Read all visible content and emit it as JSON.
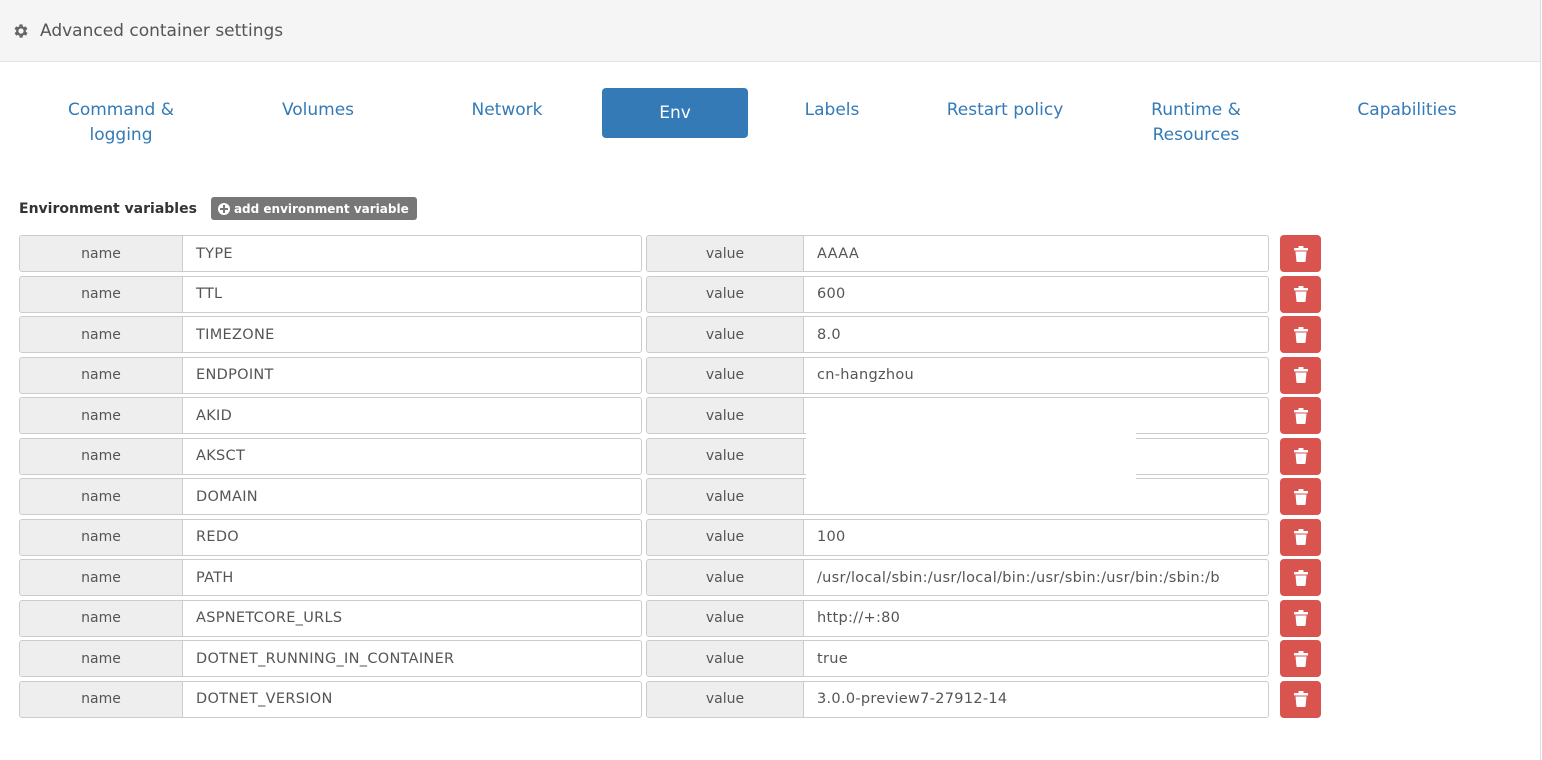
{
  "header": {
    "title": "Advanced container settings",
    "icon": "gear-icon"
  },
  "tabs": [
    {
      "line1": "Command &",
      "line2": "logging",
      "active": false
    },
    {
      "line1": "Volumes",
      "line2": "",
      "active": false
    },
    {
      "line1": "Network",
      "line2": "",
      "active": false
    },
    {
      "line1": "Env",
      "line2": "",
      "active": true
    },
    {
      "line1": "Labels",
      "line2": "",
      "active": false
    },
    {
      "line1": "Restart policy",
      "line2": "",
      "active": false
    },
    {
      "line1": "Runtime &",
      "line2": "Resources",
      "active": false
    },
    {
      "line1": "Capabilities",
      "line2": "",
      "active": false
    }
  ],
  "env": {
    "label": "Environment variables",
    "add_button": "add environment variable",
    "name_addon": "name",
    "value_addon": "value",
    "rows": [
      {
        "name": "TYPE",
        "value": "AAAA"
      },
      {
        "name": "TTL",
        "value": "600"
      },
      {
        "name": "TIMEZONE",
        "value": "8.0"
      },
      {
        "name": "ENDPOINT",
        "value": "cn-hangzhou"
      },
      {
        "name": "AKID",
        "value": ""
      },
      {
        "name": "AKSCT",
        "value": ""
      },
      {
        "name": "DOMAIN",
        "value": ""
      },
      {
        "name": "REDO",
        "value": "100"
      },
      {
        "name": "PATH",
        "value": "/usr/local/sbin:/usr/local/bin:/usr/sbin:/usr/bin:/sbin:/b"
      },
      {
        "name": "ASPNETCORE_URLS",
        "value": "http://+:80"
      },
      {
        "name": "DOTNET_RUNNING_IN_CONTAINER",
        "value": "true"
      },
      {
        "name": "DOTNET_VERSION",
        "value": "3.0.0-preview7-27912-14"
      }
    ]
  },
  "colors": {
    "primary": "#337ab7",
    "danger": "#d9534f",
    "addon_bg": "#eeeeee",
    "header_bg": "#f5f5f5"
  }
}
